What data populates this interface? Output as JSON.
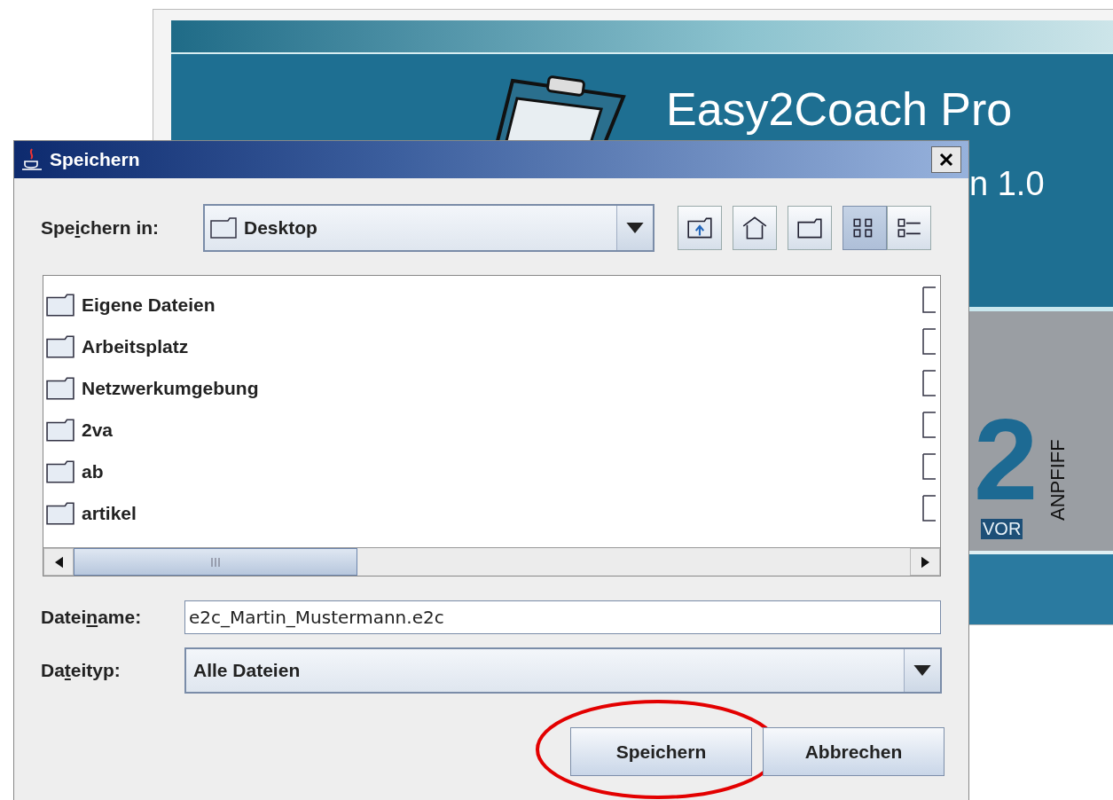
{
  "background_window": {
    "title": "Easy2Coach Pro",
    "subtitle": "n 1.0",
    "logo": {
      "numeral": "2",
      "lower": "VOR",
      "side": "ANPFIFF"
    }
  },
  "dialog": {
    "title": "Speichern",
    "save_in": {
      "label": {
        "before": "Spe",
        "underlined": "i",
        "after": "chern in:"
      },
      "value": "Desktop"
    },
    "toolbar": [
      {
        "kind": "up",
        "selected": false
      },
      {
        "kind": "home",
        "selected": false
      },
      {
        "kind": "new-folder",
        "selected": false
      },
      {
        "kind": "list",
        "selected": true
      },
      {
        "kind": "details",
        "selected": false
      }
    ],
    "files": [
      "Eigene Dateien",
      "Arbeitsplatz",
      "Netzwerkumgebung",
      "2va",
      "ab",
      "artikel"
    ],
    "file_name": {
      "label": {
        "before": "Datei",
        "underlined": "n",
        "after": "ame:"
      },
      "value": "e2c_Martin_Mustermann.e2c"
    },
    "file_type": {
      "label": {
        "before": "Da",
        "underlined": "t",
        "after": "eityp:"
      },
      "value": "Alle Dateien"
    },
    "buttons": [
      {
        "label": "Speichern",
        "highlighted": true
      },
      {
        "label": "Abbrechen",
        "highlighted": false
      }
    ]
  }
}
